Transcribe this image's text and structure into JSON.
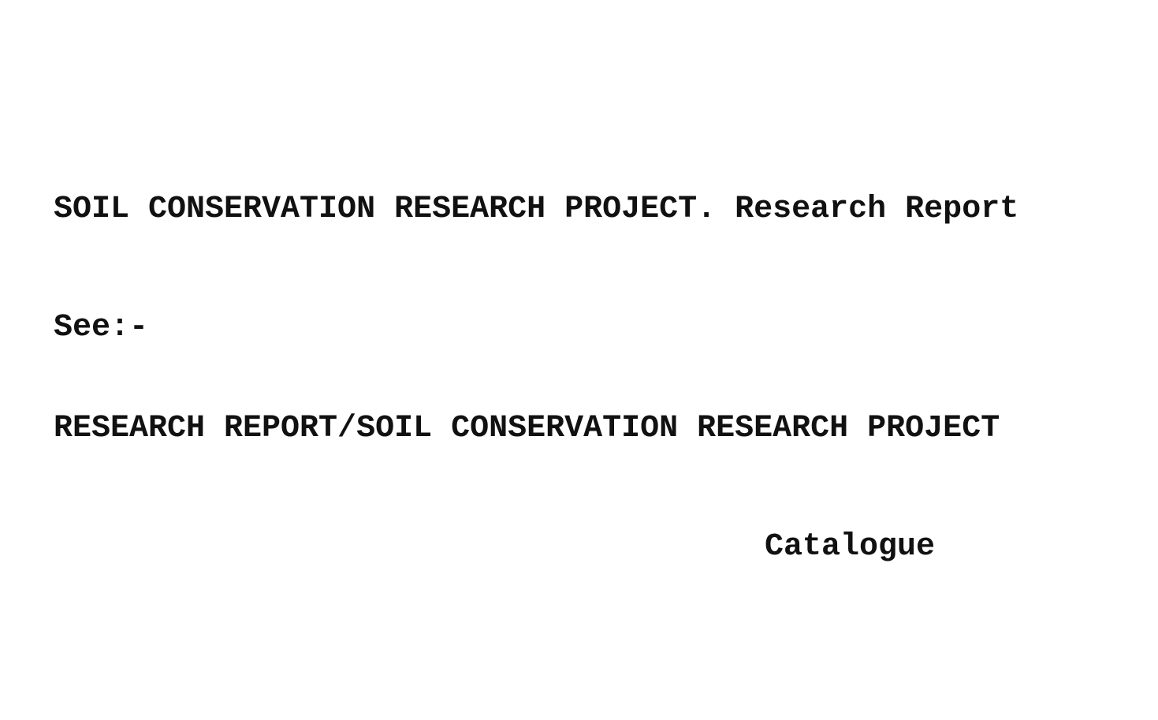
{
  "card": {
    "heading": "SOIL CONSERVATION RESEARCH PROJECT. Research Report",
    "see_label": "See:-",
    "reference": "RESEARCH REPORT/SOIL CONSERVATION RESEARCH PROJECT",
    "catalogue_label": "Catalogue"
  }
}
